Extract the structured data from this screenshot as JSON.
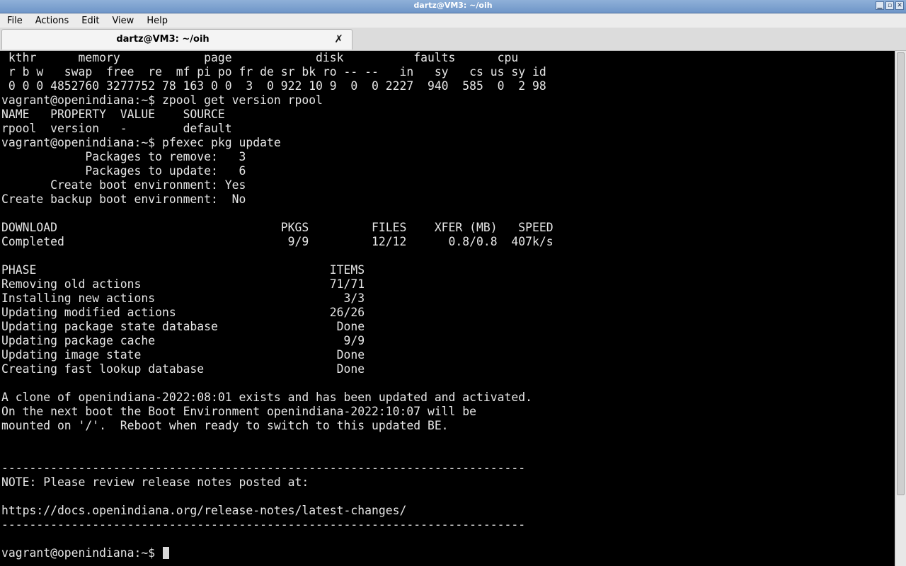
{
  "window": {
    "title": "dartz@VM3: ~/oih",
    "controls": [
      "▁",
      "▫",
      "✕"
    ]
  },
  "menubar": {
    "items": [
      "File",
      "Actions",
      "Edit",
      "View",
      "Help"
    ]
  },
  "tabs": [
    {
      "label": "dartz@VM3: ~/oih",
      "close_icon": "✗"
    }
  ],
  "terminal": {
    "lines": [
      " kthr      memory            page            disk          faults      cpu",
      " r b w   swap  free  re  mf pi po fr de sr bk ro -- --   in   sy   cs us sy id",
      " 0 0 0 4852760 3277752 78 163 0 0  3  0 922 10 9  0  0 2227  940  585  0  2 98",
      "vagrant@openindiana:~$ zpool get version rpool",
      "NAME   PROPERTY  VALUE    SOURCE",
      "rpool  version   -        default",
      "vagrant@openindiana:~$ pfexec pkg update",
      "            Packages to remove:   3",
      "            Packages to update:   6",
      "       Create boot environment: Yes",
      "Create backup boot environment:  No",
      "",
      "DOWNLOAD                                PKGS         FILES    XFER (MB)   SPEED",
      "Completed                                9/9         12/12      0.8/0.8  407k/s",
      "",
      "PHASE                                          ITEMS",
      "Removing old actions                           71/71",
      "Installing new actions                           3/3",
      "Updating modified actions                      26/26",
      "Updating package state database                 Done",
      "Updating package cache                           9/9",
      "Updating image state                            Done",
      "Creating fast lookup database                   Done",
      "",
      "A clone of openindiana-2022:08:01 exists and has been updated and activated.",
      "On the next boot the Boot Environment openindiana-2022:10:07 will be",
      "mounted on '/'.  Reboot when ready to switch to this updated BE.",
      "",
      "",
      "---------------------------------------------------------------------------",
      "NOTE: Please review release notes posted at:",
      "",
      "https://docs.openindiana.org/release-notes/latest-changes/",
      "---------------------------------------------------------------------------",
      "",
      "vagrant@openindiana:~$ "
    ]
  }
}
